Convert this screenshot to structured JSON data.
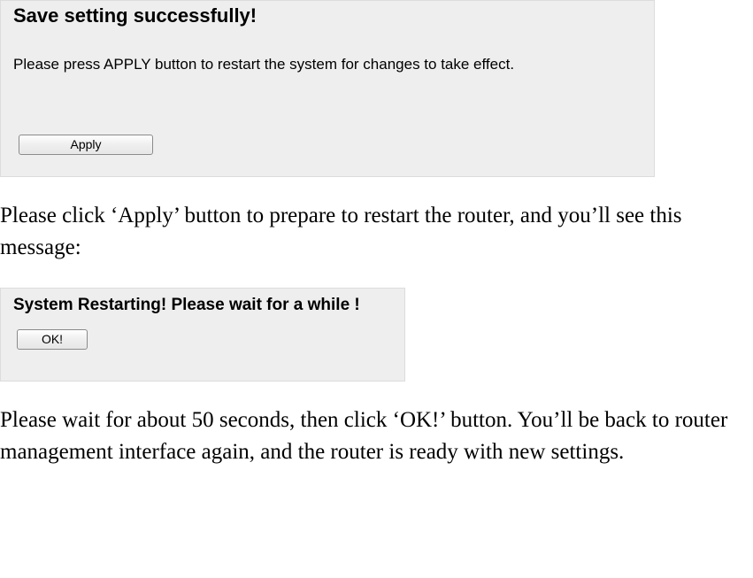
{
  "panel1": {
    "title": "Save setting successfully!",
    "subtitle": "Please press APPLY button to restart the system for changes to take effect.",
    "apply_label": "Apply"
  },
  "doc": {
    "para1": "Please click ‘Apply’ button to prepare to restart the router, and you’ll see this message:",
    "para2": "Please wait for about 50 seconds, then click ‘OK!’ button. You’ll be back to router management interface again, and the router is ready with new settings."
  },
  "panel2": {
    "title": "System Restarting! Please wait for a while !",
    "ok_label": "OK!"
  }
}
